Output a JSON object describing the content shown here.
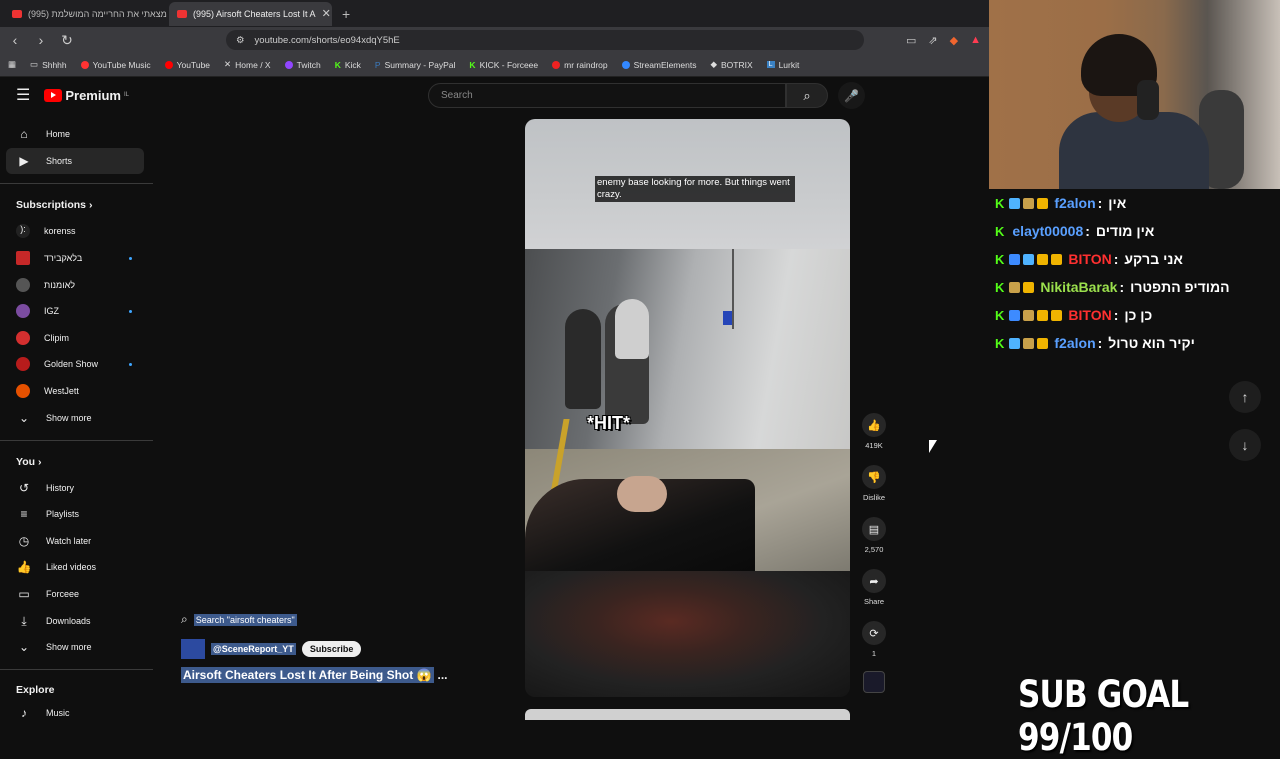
{
  "tabs": [
    {
      "label": "מצאתי את החריימה המושלמת (995)"
    },
    {
      "label": "(995) Airsoft Cheaters Lost It A"
    }
  ],
  "url": "youtube.com/shorts/eo94xdqY5hE",
  "bookmarks": [
    "Shhhh",
    "YouTube Music",
    "YouTube",
    "Home / X",
    "Twitch",
    "Kick",
    "Summary - PayPal",
    "KICK - Forceee",
    "mr raindrop",
    "StreamElements",
    "BOTRIX",
    "Lurkit"
  ],
  "yt": {
    "logo": "Premium",
    "logo_sup": "IL",
    "search_placeholder": "Search",
    "nav": {
      "home": "Home",
      "shorts": "Shorts"
    },
    "subscriptions_title": "Subscriptions",
    "channels": [
      {
        "name": "korenss",
        "color": "#222",
        "new": false
      },
      {
        "name": "בלאקבירד",
        "color": "#c62828",
        "new": true
      },
      {
        "name": "לאומנות",
        "color": "#555",
        "new": false
      },
      {
        "name": "IGZ",
        "color": "#7b4ca0",
        "new": true
      },
      {
        "name": "Clipim",
        "color": "#d32f2f",
        "new": false
      },
      {
        "name": "Golden Show",
        "color": "#b71c1c",
        "new": true
      },
      {
        "name": "WestJett",
        "color": "#e65100",
        "new": false
      }
    ],
    "show_more": "Show more",
    "you_title": "You",
    "you_items": [
      "History",
      "Playlists",
      "Watch later",
      "Liked videos",
      "Forceee",
      "Downloads"
    ],
    "show_more_2": "Show more",
    "explore_title": "Explore",
    "explore_items": [
      "Music"
    ],
    "video": {
      "caption": "enemy base looking for more. But things went crazy.",
      "hit_text": "*HIT*"
    },
    "actions": {
      "likes": "419K",
      "dislike": "Dislike",
      "comments": "2,570",
      "share": "Share",
      "remix": "1"
    },
    "overlay": {
      "search_text": "Search \"airsoft cheaters\"",
      "channel": "@SceneReport_YT",
      "subscribe": "Subscribe",
      "title": "Airsoft Cheaters Lost It After Being Shot 😱",
      "more": "..."
    }
  },
  "chat": [
    {
      "user": "f2alon",
      "user_color": "#5aa0ff",
      "msg": "אין",
      "badges": [
        "#4fb3ff",
        "#c9a14a",
        "#f0b400"
      ]
    },
    {
      "user": "elayt00008",
      "user_color": "#5aa0ff",
      "msg": "אין מודים",
      "badges": []
    },
    {
      "user": "BITON",
      "user_color": "#ff3030",
      "msg": "אני ברקע",
      "badges": [
        "#3d8bff",
        "#4fb3ff",
        "#f0b400",
        "#f0b400"
      ]
    },
    {
      "user": "NikitaBarak",
      "user_color": "#9be04d",
      "msg": "המודיפ התפטרו",
      "badges": [
        "#c9a14a",
        "#f0b400"
      ]
    },
    {
      "user": "BITON",
      "user_color": "#ff3030",
      "msg": "כן כן",
      "badges": [
        "#3d8bff",
        "#c9a14a",
        "#f0b400",
        "#f0b400"
      ]
    },
    {
      "user": "f2alon",
      "user_color": "#5aa0ff",
      "msg": "יקיר הוא טרול",
      "badges": [
        "#4fb3ff",
        "#c9a14a",
        "#f0b400"
      ]
    }
  ],
  "sub_goal": "SUB GOAL 99/100"
}
